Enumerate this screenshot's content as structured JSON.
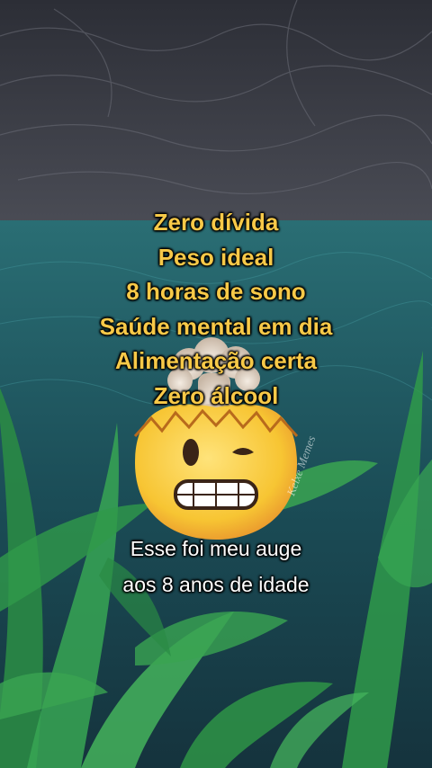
{
  "headline": {
    "lines": [
      "Zero dívida",
      "Peso ideal",
      "8 horas de sono",
      "Saúde mental em dia",
      "Alimentação certa",
      "Zero álcool"
    ]
  },
  "caption": {
    "lines": [
      "Esse foi meu auge",
      "aos 8 anos de idade"
    ]
  },
  "emoji": {
    "name": "exploding-head-icon"
  },
  "watermark": {
    "text": "Kelxe Memes"
  },
  "colors": {
    "headline": "#f7c948",
    "caption": "#ffffff",
    "sky": "#3a3d46",
    "water": "#1f5a63",
    "leaves": "#2f9a4a"
  }
}
